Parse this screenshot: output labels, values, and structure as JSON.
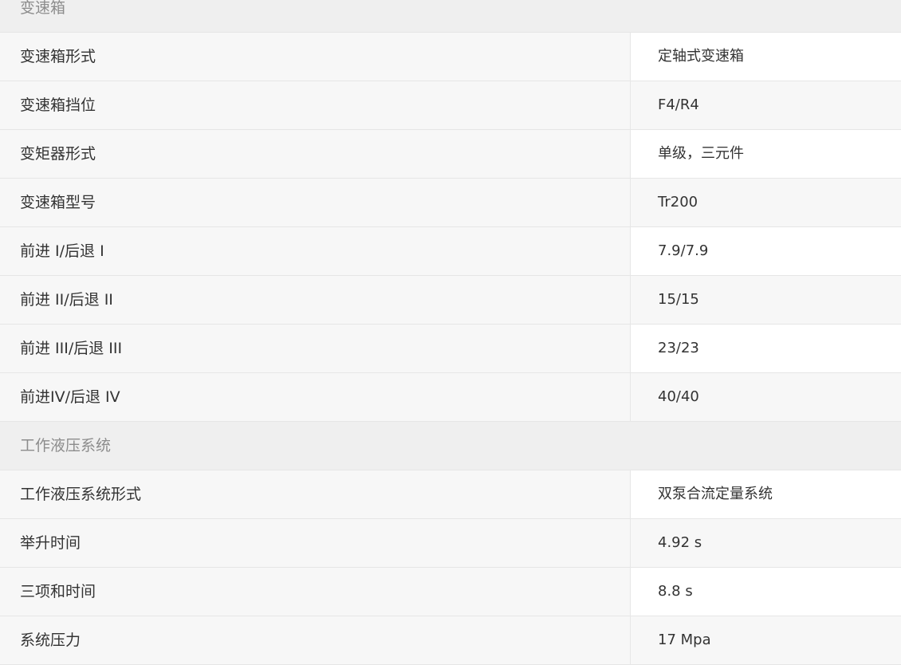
{
  "sections": [
    {
      "title": "变速箱",
      "rows": [
        {
          "label": "变速箱形式",
          "value": "定轴式变速箱"
        },
        {
          "label": "变速箱挡位",
          "value": "F4/R4"
        },
        {
          "label": "变矩器形式",
          "value": "单级，三元件"
        },
        {
          "label": "变速箱型号",
          "value": "Tr200"
        },
        {
          "label": "前进 I/后退 I",
          "value": "7.9/7.9"
        },
        {
          "label": "前进 II/后退 II",
          "value": "15/15"
        },
        {
          "label": "前进 III/后退 III",
          "value": "23/23"
        },
        {
          "label": "前进IV/后退 IV",
          "value": "40/40"
        }
      ]
    },
    {
      "title": "工作液压系统",
      "rows": [
        {
          "label": "工作液压系统形式",
          "value": "双泵合流定量系统"
        },
        {
          "label": "举升时间",
          "value": "4.92 s"
        },
        {
          "label": "三项和时间",
          "value": "8.8 s"
        },
        {
          "label": "系统压力",
          "value": "17 Mpa"
        }
      ]
    }
  ]
}
